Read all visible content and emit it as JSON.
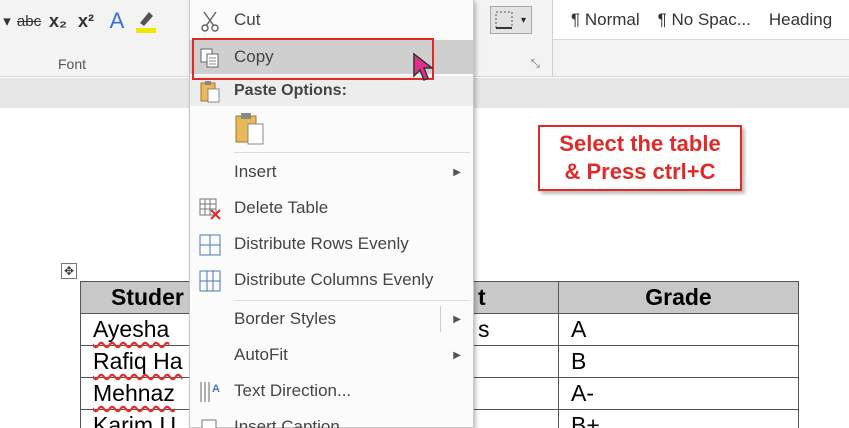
{
  "ribbon": {
    "font_group_label": "Font",
    "tools": [
      "abc",
      "x₂",
      "x²",
      "A"
    ],
    "styles": [
      "¶ Normal",
      "¶ No Spac...",
      "Heading"
    ]
  },
  "callout": {
    "line1": "Select the table",
    "line2": "& Press ctrl+C"
  },
  "table": {
    "headers": [
      "Studer",
      "t",
      "Grade"
    ],
    "rows": [
      [
        "Ayesha",
        "s",
        "A"
      ],
      [
        "Rafiq Ha",
        "",
        "B"
      ],
      [
        "Mehnaz",
        "",
        "A-"
      ],
      [
        "Karim U",
        "",
        "B+"
      ]
    ]
  },
  "context_menu": {
    "cut": "Cut",
    "copy": "Copy",
    "paste_options": "Paste Options:",
    "insert": "Insert",
    "delete_table": "Delete Table",
    "distribute_rows": "Distribute Rows Evenly",
    "distribute_columns": "Distribute Columns Evenly",
    "border_styles": "Border Styles",
    "autofit": "AutoFit",
    "text_direction": "Text Direction...",
    "insert_caption": "Insert Caption"
  },
  "colors": {
    "accent_red": "#e02a2a",
    "menu_highlight": "#cfcfcf"
  }
}
